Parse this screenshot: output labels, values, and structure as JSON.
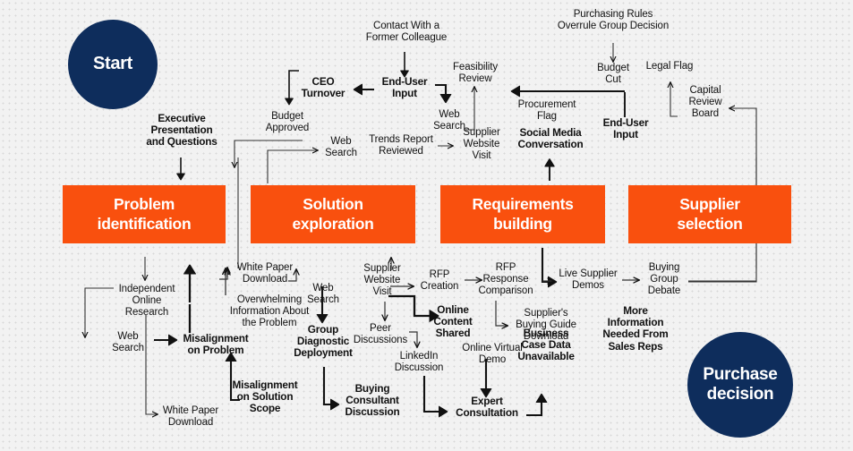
{
  "colors": {
    "stage_orange": "#f9500e",
    "circle_navy": "#0e2d5c",
    "background": "#f2f2f2",
    "line": "#111111",
    "text": "#111111"
  },
  "circles": {
    "start": {
      "label": "Start"
    },
    "end": {
      "label": "Purchase\ndecision"
    }
  },
  "stages": [
    {
      "label": "Problem\nidentification"
    },
    {
      "label": "Solution\nexploration"
    },
    {
      "label": "Requirements\nbuilding"
    },
    {
      "label": "Supplier\nselection"
    }
  ],
  "nodes": {
    "exec_presentation": "Executive\nPresentation\nand Questions",
    "ceo_turnover": "CEO\nTurnover",
    "budget_approved": "Budget\nApproved",
    "web_search_top_left": "Web\nSearch",
    "contact_former_colleague": "Contact With a\nFormer Colleague",
    "end_user_input_left": "End-User\nInput",
    "trends_report_reviewed": "Trends Report\nReviewed",
    "feasibility_review": "Feasibility\nReview",
    "web_search_top_mid": "Web\nSearch",
    "supplier_website_visit_top": "Supplier\nWebsite\nVisit",
    "procurement_flag": "Procurement\nFlag",
    "social_media_conversation": "Social Media\nConversation",
    "purchasing_rules": "Purchasing Rules\nOverrule Group Decision",
    "budget_cut": "Budget\nCut",
    "end_user_input_right": "End-User\nInput",
    "legal_flag": "Legal Flag",
    "capital_review_board": "Capital\nReview\nBoard",
    "independent_online_research": "Independent\nOnline\nResearch",
    "web_search_bottom_left": "Web\nSearch",
    "white_paper_download_bottom": "White Paper\nDownload",
    "misalignment_on_problem": "Misalignment\non Problem",
    "white_paper_download_mid": "White Paper\nDownload",
    "overwhelming_information": "Overwhelming\nInformation About\nthe Problem",
    "misalignment_on_solution_scope": "Misalignment\non Solution\nScope",
    "web_search_bottom_mid": "Web\nSearch",
    "group_diagnostic_deployment": "Group\nDiagnostic\nDeployment",
    "buying_consultant_discussion": "Buying\nConsultant\nDiscussion",
    "supplier_website_visit_bottom": "Supplier\nWebsite\nVisit",
    "peer_discussions": "Peer\nDiscussions",
    "linkedin_discussion": "LinkedIn\nDiscussion",
    "rfp_creation": "RFP\nCreation",
    "online_content_shared": "Online\nContent\nShared",
    "online_virtual_demo": "Online Virtual\nDemo",
    "expert_consultation": "Expert\nConsultation",
    "rfp_response_comparison": "RFP\nResponse\nComparison",
    "suppliers_buying_guide_download": "Supplier's\nBuying Guide\nDownload",
    "business_case_data_unavailable": "Business\nCase Data\nUnavailable",
    "live_supplier_demos": "Live Supplier\nDemos",
    "more_information_needed": "More\nInformation\nNeeded From\nSales Reps",
    "buying_group_debate": "Buying\nGroup\nDebate"
  }
}
